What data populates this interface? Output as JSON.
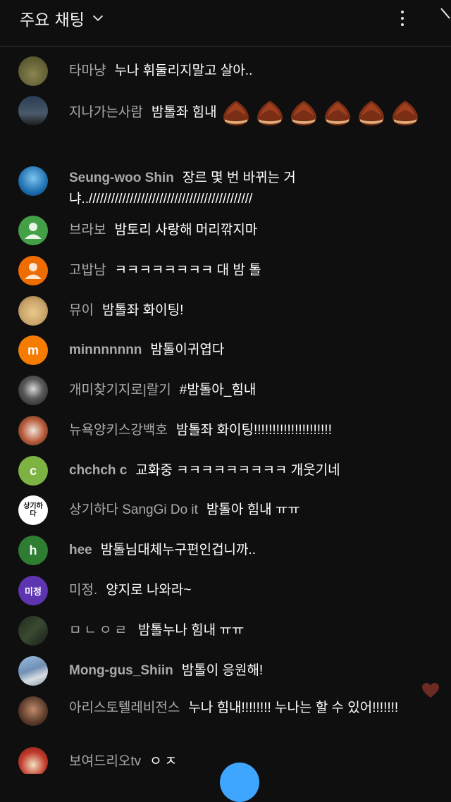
{
  "header": {
    "title": "주요 채팅"
  },
  "messages": [
    {
      "author": "타마냥",
      "text": "누나 휘둘리지말고 살아..",
      "avatar_color": "#6b6a3a"
    },
    {
      "author": "지나가는사람",
      "text": "밤톨좌 힘내",
      "avatar_color": "#2a3b55",
      "emoji_count": 6,
      "emoji": "chestnut-emoji"
    },
    {
      "author": "Seung-woo Shin",
      "text": "장르 몇 번 바뀌는 거냐..////////////////////////////////////////////",
      "avatar_color": "#1e6fb0"
    },
    {
      "author": "브라보",
      "text": "밤토리 사랑해 머리깎지마",
      "avatar_color": "#43a047"
    },
    {
      "author": "고밥남",
      "text": "ㅋㅋㅋㅋㅋㅋㅋㅋ 대 밤 톨",
      "avatar_color": "#ef6c00"
    },
    {
      "author": "뮤이",
      "text": "밤톨좌 화이팅!",
      "avatar_color": "#c9a46a"
    },
    {
      "author": "minnnnnnn",
      "text": "밤톨이귀엽다",
      "avatar_color": "#f57c00",
      "avatar_letter": "m"
    },
    {
      "author": "개미찾기지로|랄기",
      "text": "#밤톨아_힘내",
      "avatar_color": "#3a3a3a"
    },
    {
      "author": "뉴욕양키스강백호",
      "text": "밤톨좌 화이팅!!!!!!!!!!!!!!!!!!!!!",
      "avatar_color": "#8a4a2a"
    },
    {
      "author": "chchch c",
      "text": "교화중 ㅋㅋㅋㅋㅋㅋㅋㅋㅋ 개웃기네",
      "avatar_color": "#7cb342",
      "avatar_letter": "c"
    },
    {
      "author": "상기하다 SangGi Do it",
      "text": "밤톨아 힘내 ㅠㅠ",
      "avatar_color": "#ffffff",
      "avatar_letter": "상기하다"
    },
    {
      "author": "hee",
      "text": "밤톨님대체누구편인겁니까..",
      "avatar_color": "#2e7d32",
      "avatar_letter": "h"
    },
    {
      "author": "미정.",
      "text": "양지로 나와라~",
      "avatar_color": "#5e35b1",
      "avatar_letter": "미정"
    },
    {
      "author": "ㅁㄴㅇㄹ",
      "text": "밤톨누나 힘내 ㅠㅠ",
      "avatar_color": "#1f2a1f"
    },
    {
      "author": "Mong-gus_Shiin",
      "text": "밤톨이 응원해!",
      "avatar_color": "#6f8fb5"
    },
    {
      "author": "아리스토텔레비전스",
      "text": "누나 힘내!!!!!!!! 누나는 할 수 있어!!!!!!!",
      "avatar_color": "#5a3a2a"
    },
    {
      "author": "보여드리오tv",
      "text": "ㅇㅈ",
      "avatar_color": "#c0392b"
    }
  ]
}
